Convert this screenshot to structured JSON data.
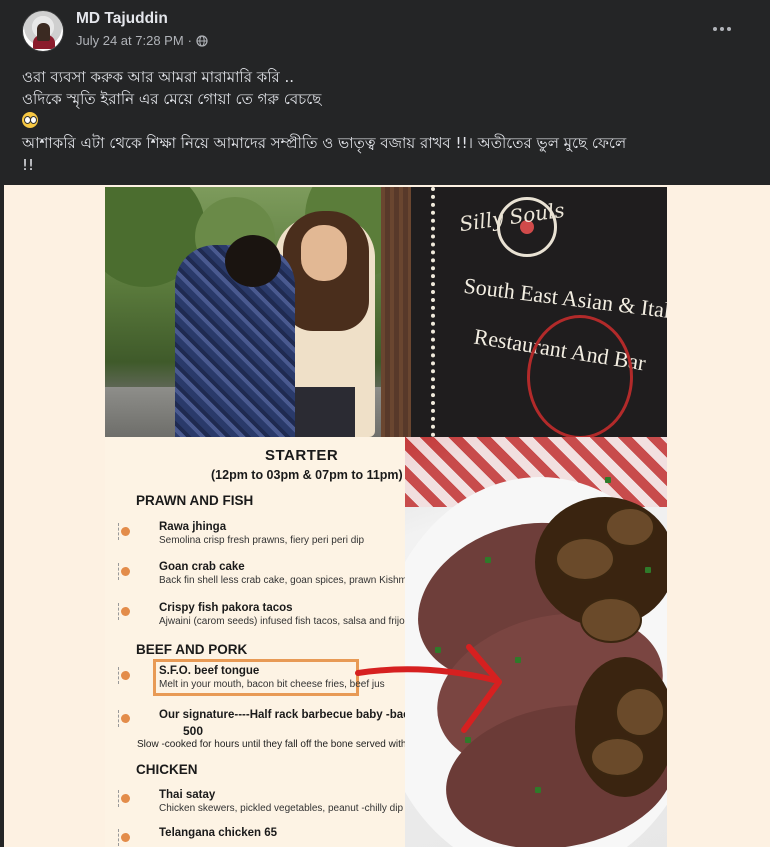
{
  "post": {
    "author": "MD Tajuddin",
    "timestamp": "July 24 at 7:28 PM",
    "privacy_icon": "globe-icon",
    "more_icon": "more-options-icon",
    "text_lines": [
      "ওরা ব্যবসা করুক আর আমরা মারামারি করি ..",
      "ওদিকে স্মৃতি ইরানি এর মেয়ে গোয়া তে গরু বেচছে",
      "আশাকরি এটা থেকে শিক্ষা নিয়ে আমাদের সম্প্রীতি ও ভাতৃত্ব বজায় রাখব !!। অতীতের ভুল মুছে ফেলে",
      "!!"
    ],
    "emoji": "flushed-face-emoji"
  },
  "sign": {
    "script": "Silly Souls",
    "line1": "South East Asian & Italian",
    "line2": "Restaurant And Bar"
  },
  "menu": {
    "title": "STARTER",
    "timing": "(12pm to 03pm & 07pm to 11pm)",
    "sections": [
      {
        "name": "PRAWN AND FISH",
        "items": [
          {
            "name": "Rawa jhinga",
            "desc": "Semolina crisp fresh prawns, fiery peri peri dip"
          },
          {
            "name": "Goan crab cake",
            "desc": "Back fin shell less crab cake, goan spices, prawn Kishmur salad"
          },
          {
            "name": "Crispy fish pakora tacos",
            "desc": "Ajwaini (carom seeds) infused fish tacos, salsa and frijoles"
          }
        ]
      },
      {
        "name": "BEEF AND PORK",
        "items": [
          {
            "name": "S.F.O. beef tongue",
            "desc": "Melt in your mouth, bacon bit cheese fries, beef jus"
          },
          {
            "name": "Our signature----Half rack barbecue baby -back ribs",
            "price": "500",
            "desc": "Slow -cooked for hours until they fall off the bone served with cheese fr"
          }
        ]
      },
      {
        "name": "CHICKEN",
        "items": [
          {
            "name": "Thai satay",
            "desc": "Chicken skewers, pickled vegetables, peanut -chilly dip"
          },
          {
            "name": "Telangana chicken 65",
            "desc": ""
          }
        ]
      }
    ]
  },
  "colors": {
    "background": "#242526",
    "text": "#e4e6eb",
    "secondary_text": "#b0b3b8",
    "highlight_box": "#e89a55",
    "annotation_red": "#d62020"
  }
}
